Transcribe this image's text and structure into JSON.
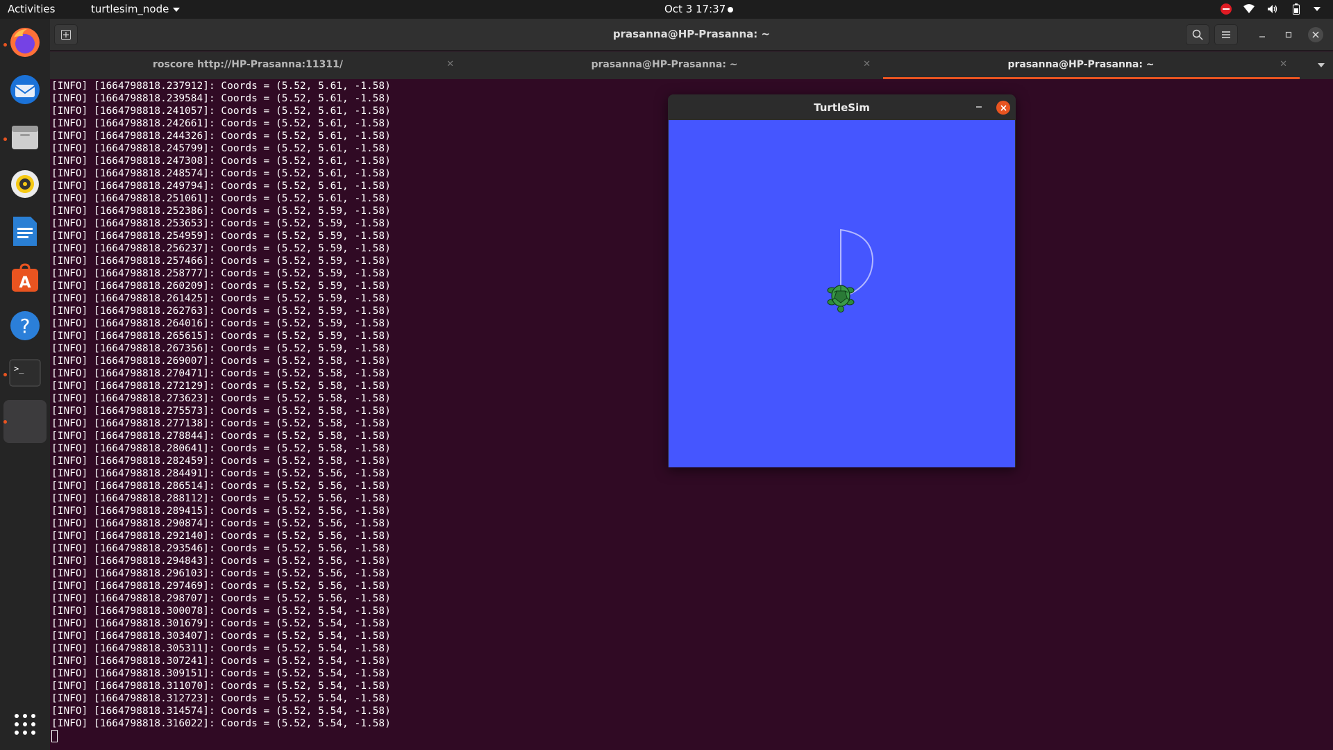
{
  "topbar": {
    "activities": "Activities",
    "app_menu": "turtlesim_node",
    "clock": "Oct 3  17:37"
  },
  "dock": {
    "items": [
      "firefox-icon",
      "thunderbird-icon",
      "files-icon",
      "rhythmbox-icon",
      "libreoffice-writer-icon",
      "software-center-icon",
      "help-icon",
      "terminal-icon",
      "turtlesim-window-icon"
    ],
    "terminal_glyph": ">_",
    "help_glyph": "?",
    "store_glyph": "A"
  },
  "terminal": {
    "title": "prasanna@HP-Prasanna: ~",
    "tabs": [
      {
        "label": "roscore http://HP-Prasanna:11311/",
        "active": false
      },
      {
        "label": "prasanna@HP-Prasanna: ~",
        "active": false
      },
      {
        "label": "prasanna@HP-Prasanna: ~",
        "active": true
      }
    ],
    "log_lines": [
      "[INFO] [1664798818.237912]: Coords = (5.52, 5.61, -1.58)",
      "[INFO] [1664798818.239584]: Coords = (5.52, 5.61, -1.58)",
      "[INFO] [1664798818.241057]: Coords = (5.52, 5.61, -1.58)",
      "[INFO] [1664798818.242661]: Coords = (5.52, 5.61, -1.58)",
      "[INFO] [1664798818.244326]: Coords = (5.52, 5.61, -1.58)",
      "[INFO] [1664798818.245799]: Coords = (5.52, 5.61, -1.58)",
      "[INFO] [1664798818.247308]: Coords = (5.52, 5.61, -1.58)",
      "[INFO] [1664798818.248574]: Coords = (5.52, 5.61, -1.58)",
      "[INFO] [1664798818.249794]: Coords = (5.52, 5.61, -1.58)",
      "[INFO] [1664798818.251061]: Coords = (5.52, 5.61, -1.58)",
      "[INFO] [1664798818.252386]: Coords = (5.52, 5.59, -1.58)",
      "[INFO] [1664798818.253653]: Coords = (5.52, 5.59, -1.58)",
      "[INFO] [1664798818.254959]: Coords = (5.52, 5.59, -1.58)",
      "[INFO] [1664798818.256237]: Coords = (5.52, 5.59, -1.58)",
      "[INFO] [1664798818.257466]: Coords = (5.52, 5.59, -1.58)",
      "[INFO] [1664798818.258777]: Coords = (5.52, 5.59, -1.58)",
      "[INFO] [1664798818.260209]: Coords = (5.52, 5.59, -1.58)",
      "[INFO] [1664798818.261425]: Coords = (5.52, 5.59, -1.58)",
      "[INFO] [1664798818.262763]: Coords = (5.52, 5.59, -1.58)",
      "[INFO] [1664798818.264016]: Coords = (5.52, 5.59, -1.58)",
      "[INFO] [1664798818.265615]: Coords = (5.52, 5.59, -1.58)",
      "[INFO] [1664798818.267356]: Coords = (5.52, 5.59, -1.58)",
      "[INFO] [1664798818.269007]: Coords = (5.52, 5.58, -1.58)",
      "[INFO] [1664798818.270471]: Coords = (5.52, 5.58, -1.58)",
      "[INFO] [1664798818.272129]: Coords = (5.52, 5.58, -1.58)",
      "[INFO] [1664798818.273623]: Coords = (5.52, 5.58, -1.58)",
      "[INFO] [1664798818.275573]: Coords = (5.52, 5.58, -1.58)",
      "[INFO] [1664798818.277138]: Coords = (5.52, 5.58, -1.58)",
      "[INFO] [1664798818.278844]: Coords = (5.52, 5.58, -1.58)",
      "[INFO] [1664798818.280641]: Coords = (5.52, 5.58, -1.58)",
      "[INFO] [1664798818.282459]: Coords = (5.52, 5.58, -1.58)",
      "[INFO] [1664798818.284491]: Coords = (5.52, 5.56, -1.58)",
      "[INFO] [1664798818.286514]: Coords = (5.52, 5.56, -1.58)",
      "[INFO] [1664798818.288112]: Coords = (5.52, 5.56, -1.58)",
      "[INFO] [1664798818.289415]: Coords = (5.52, 5.56, -1.58)",
      "[INFO] [1664798818.290874]: Coords = (5.52, 5.56, -1.58)",
      "[INFO] [1664798818.292140]: Coords = (5.52, 5.56, -1.58)",
      "[INFO] [1664798818.293546]: Coords = (5.52, 5.56, -1.58)",
      "[INFO] [1664798818.294843]: Coords = (5.52, 5.56, -1.58)",
      "[INFO] [1664798818.296103]: Coords = (5.52, 5.56, -1.58)",
      "[INFO] [1664798818.297469]: Coords = (5.52, 5.56, -1.58)",
      "[INFO] [1664798818.298707]: Coords = (5.52, 5.56, -1.58)",
      "[INFO] [1664798818.300078]: Coords = (5.52, 5.54, -1.58)",
      "[INFO] [1664798818.301679]: Coords = (5.52, 5.54, -1.58)",
      "[INFO] [1664798818.303407]: Coords = (5.52, 5.54, -1.58)",
      "[INFO] [1664798818.305311]: Coords = (5.52, 5.54, -1.58)",
      "[INFO] [1664798818.307241]: Coords = (5.52, 5.54, -1.58)",
      "[INFO] [1664798818.309151]: Coords = (5.52, 5.54, -1.58)",
      "[INFO] [1664798818.311070]: Coords = (5.52, 5.54, -1.58)",
      "[INFO] [1664798818.312723]: Coords = (5.52, 5.54, -1.58)",
      "[INFO] [1664798818.314574]: Coords = (5.52, 5.54, -1.58)",
      "[INFO] [1664798818.316022]: Coords = (5.52, 5.54, -1.58)"
    ]
  },
  "turtlesim": {
    "title": "TurtleSim",
    "background_color": "#4556ff",
    "pen_color": "#b3b8ff",
    "turtle_color": "#2e8b3e"
  },
  "colors": {
    "accent": "#e95420",
    "terminal_bg": "#300a24",
    "topbar_bg": "#1d1d1d"
  }
}
